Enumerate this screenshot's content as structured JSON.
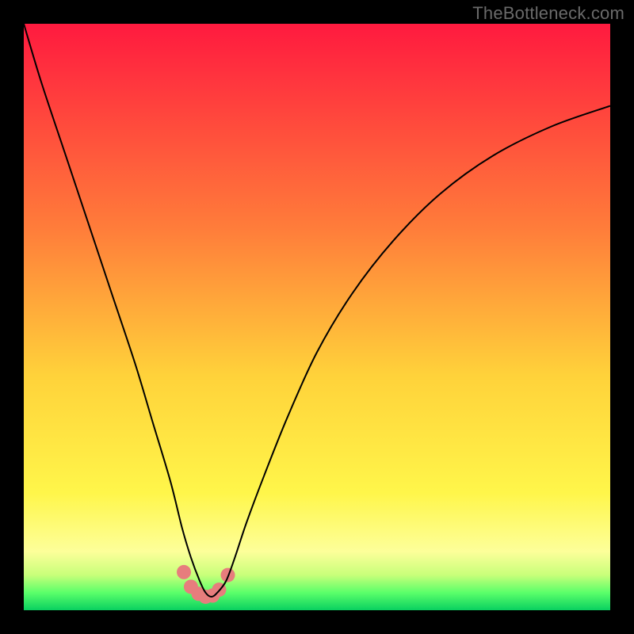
{
  "watermark": "TheBottleneck.com",
  "chart_data": {
    "type": "line",
    "title": "",
    "xlabel": "",
    "ylabel": "",
    "xlim": [
      0,
      100
    ],
    "ylim": [
      0,
      100
    ],
    "grid": false,
    "legend": false,
    "background_gradient": {
      "stops": [
        {
          "pos": 0.0,
          "color": "#ff1a3f"
        },
        {
          "pos": 0.35,
          "color": "#ff7d3a"
        },
        {
          "pos": 0.6,
          "color": "#ffd23a"
        },
        {
          "pos": 0.8,
          "color": "#fff64a"
        },
        {
          "pos": 0.9,
          "color": "#fdff9a"
        },
        {
          "pos": 0.94,
          "color": "#c8ff7a"
        },
        {
          "pos": 0.97,
          "color": "#5bff6a"
        },
        {
          "pos": 1.0,
          "color": "#09d060"
        }
      ]
    },
    "series": [
      {
        "name": "curve",
        "color": "#000000",
        "width": 2,
        "x": [
          0.0,
          3.0,
          7.0,
          11.0,
          15.0,
          19.0,
          22.0,
          25.0,
          27.0,
          28.5,
          30.0,
          31.0,
          32.0,
          33.0,
          34.5,
          36.0,
          38.0,
          41.0,
          45.0,
          50.0,
          56.0,
          63.0,
          71.0,
          80.0,
          90.0,
          100.0
        ],
        "y": [
          100.0,
          90.0,
          78.0,
          66.0,
          54.0,
          42.0,
          32.0,
          22.0,
          14.0,
          9.0,
          5.0,
          3.0,
          2.3,
          3.0,
          5.0,
          9.0,
          15.0,
          23.0,
          33.0,
          44.0,
          54.0,
          63.0,
          71.0,
          77.5,
          82.5,
          86.0
        ]
      },
      {
        "name": "marker-band",
        "type": "scatter",
        "color": "#e77d7d",
        "marker_radius_px": 9,
        "x": [
          27.3,
          28.5,
          29.8,
          31.0,
          32.2,
          33.3,
          34.8
        ],
        "y": [
          6.5,
          4.0,
          2.8,
          2.3,
          2.5,
          3.5,
          6.0
        ]
      }
    ]
  }
}
